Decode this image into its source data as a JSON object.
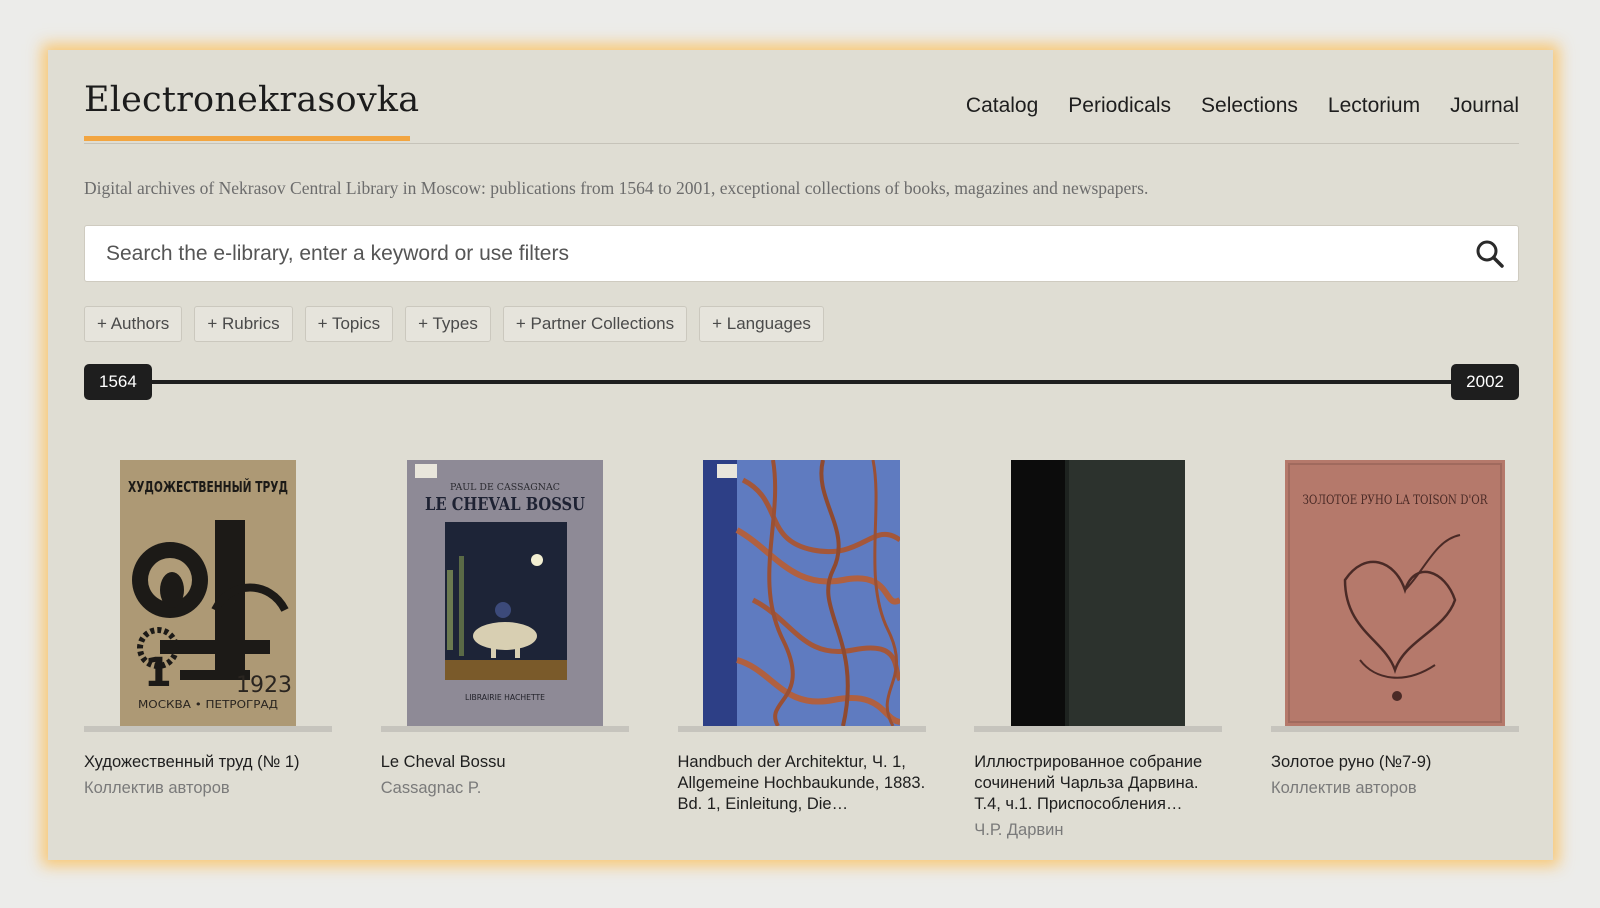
{
  "brand": {
    "name": "Electronekrasovka",
    "accent_color": "#f2a541"
  },
  "nav": {
    "items": [
      {
        "label": "Catalog"
      },
      {
        "label": "Periodicals"
      },
      {
        "label": "Selections"
      },
      {
        "label": "Lectorium"
      },
      {
        "label": "Journal"
      }
    ]
  },
  "tagline": "Digital archives of Nekrasov Central Library in Moscow: publications from 1564 to 2001, exceptional collections of books, magazines and newspapers.",
  "search": {
    "placeholder": "Search the e-library, enter a keyword or use filters",
    "value": "",
    "icon": "search-icon"
  },
  "filters": [
    {
      "label": "+ Authors"
    },
    {
      "label": "+ Rubrics"
    },
    {
      "label": "+ Topics"
    },
    {
      "label": "+ Types"
    },
    {
      "label": "+ Partner Collections"
    },
    {
      "label": "+ Languages"
    }
  ],
  "year_range": {
    "min": "1564",
    "max": "2002"
  },
  "books": [
    {
      "title": "Художественный труд (№ 1)",
      "author": "Коллектив авторов",
      "cover_title": "ХУДОЖЕСТВЕННЫЙ ТРУД",
      "cover_number": "1",
      "cover_year": "1923",
      "cover_city": "МОСКВА • ПЕТРОГРАД"
    },
    {
      "title": "Le Cheval Bossu",
      "author": "Cassagnac P.",
      "cover_subtitle": "PAUL DE CASSAGNAC",
      "cover_title": "LE CHEVAL BOSSU",
      "cover_publisher": "LIBRAIRIE HACHETTE"
    },
    {
      "title": "Handbuch der Architektur, Ч. 1, Allgemeine Hochbaukunde, 1883. Bd. 1, Einleitung, Die…",
      "author": ""
    },
    {
      "title": "Иллюстрированное собрание сочинений Чарльза Дарвина. Т.4, ч.1. Приспособления…",
      "author": "Ч.Р. Дарвин"
    },
    {
      "title": "Золотое руно (№7-9)",
      "author": "Коллектив авторов",
      "cover_title": "ЗОЛОТОЕ РУНО  LA TOISON D'OR"
    }
  ]
}
